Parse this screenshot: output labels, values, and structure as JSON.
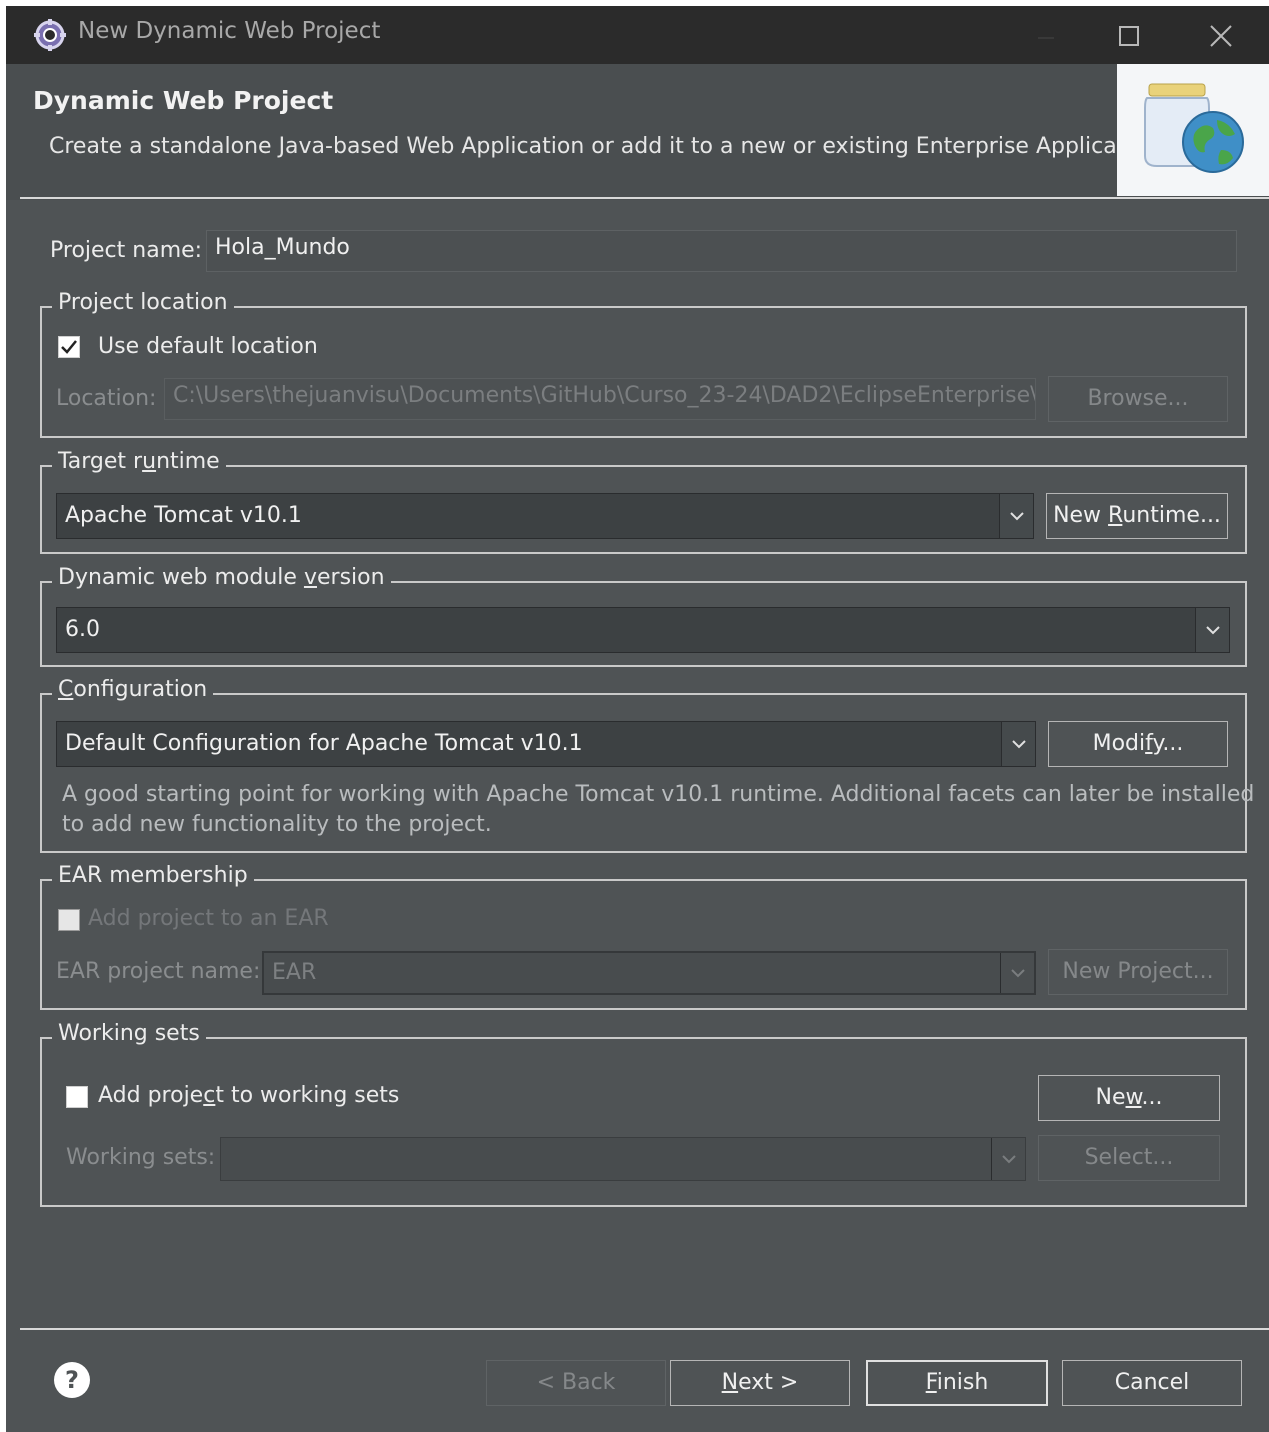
{
  "window": {
    "title": "New Dynamic Web Project",
    "controls": [
      "minimize-icon",
      "maximize-icon",
      "close-icon"
    ]
  },
  "header": {
    "title": "Dynamic Web Project",
    "description": "Create a standalone Java-based Web Application or add it to a new or existing Enterprise Application.",
    "image_icon": "web-project-jar-globe-icon"
  },
  "project_name": {
    "label": "Project name:",
    "value": "Hola_Mundo"
  },
  "project_location": {
    "legend": "Project location",
    "use_default_label": "Use default location",
    "use_default_checked": true,
    "location_label": "Location:",
    "location_value": "C:\\Users\\thejuanvisu\\Documents\\GitHub\\Curso_23-24\\DAD2\\EclipseEnterprise\\H",
    "browse_label": "Browse..."
  },
  "target_runtime": {
    "legend": "Target runtime",
    "selected": "Apache Tomcat v10.1",
    "new_runtime_label": "New Runtime..."
  },
  "module_version": {
    "legend": "Dynamic web module version",
    "selected": "6.0"
  },
  "configuration": {
    "legend": "Configuration",
    "selected": "Default Configuration for Apache Tomcat v10.1",
    "modify_label": "Modify...",
    "description_line1": "A good starting point for working with Apache Tomcat v10.1 runtime. Additional facets can later be installed",
    "description_line2": "to add new functionality to the project."
  },
  "ear_membership": {
    "legend": "EAR membership",
    "add_label": "Add project to an EAR",
    "add_checked": false,
    "name_label": "EAR project name:",
    "name_value": "EAR",
    "new_project_label": "New Project..."
  },
  "working_sets": {
    "legend": "Working sets",
    "add_label": "Add project to working sets",
    "add_checked": false,
    "new_label": "New...",
    "sets_label": "Working sets:",
    "sets_value": "",
    "select_label": "Select..."
  },
  "footer": {
    "help_icon": "help-icon",
    "back_label": "< Back",
    "next_label": "Next >",
    "finish_label": "Finish",
    "cancel_label": "Cancel"
  },
  "colors": {
    "window_bg": "#4f5355",
    "titlebar_bg": "#2b2b2b",
    "combo_bg": "#3d4143",
    "group_border": "#c9c9c9"
  }
}
